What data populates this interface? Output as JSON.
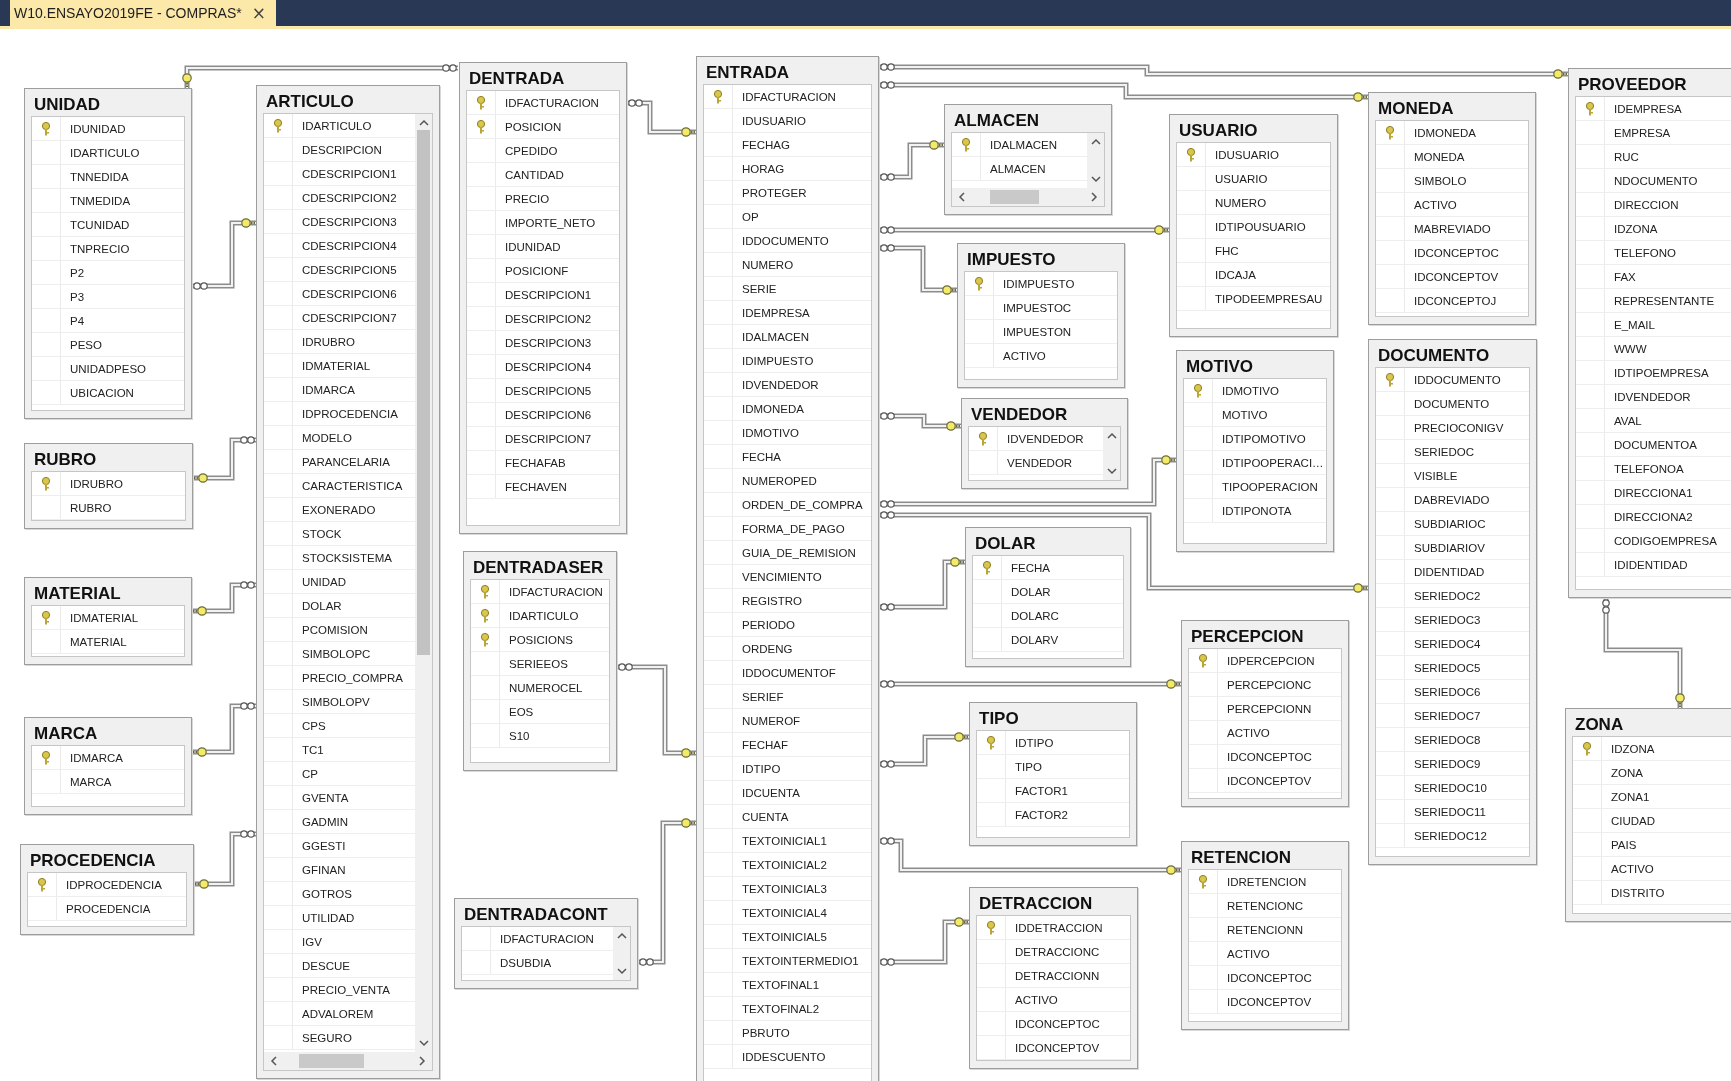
{
  "tab": {
    "title": "W10.ENSAYO2019FE - COMPRAS*",
    "close": "×",
    "selected": true
  },
  "tables": [
    {
      "name": "UNIDAD",
      "columns": [
        {
          "name": "IDUNIDAD",
          "key": true
        },
        {
          "name": "IDARTICULO",
          "key": false
        },
        {
          "name": "TNNEDIDA",
          "key": false
        },
        {
          "name": "TNMEDIDA",
          "key": false
        },
        {
          "name": "TCUNIDAD",
          "key": false
        },
        {
          "name": "TNPRECIO",
          "key": false
        },
        {
          "name": "P2",
          "key": false
        },
        {
          "name": "P3",
          "key": false
        },
        {
          "name": "P4",
          "key": false
        },
        {
          "name": "PESO",
          "key": false
        },
        {
          "name": "UNIDADPESO",
          "key": false
        },
        {
          "name": "UBICACION",
          "key": false
        }
      ]
    },
    {
      "name": "RUBRO",
      "columns": [
        {
          "name": "IDRUBRO",
          "key": true
        },
        {
          "name": "RUBRO",
          "key": false
        }
      ]
    },
    {
      "name": "MATERIAL",
      "columns": [
        {
          "name": "IDMATERIAL",
          "key": true
        },
        {
          "name": "MATERIAL",
          "key": false
        }
      ]
    },
    {
      "name": "MARCA",
      "columns": [
        {
          "name": "IDMARCA",
          "key": true
        },
        {
          "name": "MARCA",
          "key": false
        }
      ]
    },
    {
      "name": "PROCEDENCIA",
      "columns": [
        {
          "name": "IDPROCEDENCIA",
          "key": true
        },
        {
          "name": "PROCEDENCIA",
          "key": false
        }
      ]
    },
    {
      "name": "ARTICULO",
      "columns": [
        {
          "name": "IDARTICULO",
          "key": true
        },
        {
          "name": "DESCRIPCION",
          "key": false
        },
        {
          "name": "CDESCRIPCION1",
          "key": false
        },
        {
          "name": "CDESCRIPCION2",
          "key": false
        },
        {
          "name": "CDESCRIPCION3",
          "key": false
        },
        {
          "name": "CDESCRIPCION4",
          "key": false
        },
        {
          "name": "CDESCRIPCION5",
          "key": false
        },
        {
          "name": "CDESCRIPCION6",
          "key": false
        },
        {
          "name": "CDESCRIPCION7",
          "key": false
        },
        {
          "name": "IDRUBRO",
          "key": false
        },
        {
          "name": "IDMATERIAL",
          "key": false
        },
        {
          "name": "IDMARCA",
          "key": false
        },
        {
          "name": "IDPROCEDENCIA",
          "key": false
        },
        {
          "name": "MODELO",
          "key": false
        },
        {
          "name": "PARANCELARIA",
          "key": false
        },
        {
          "name": "CARACTERISTICA",
          "key": false
        },
        {
          "name": "EXONERADO",
          "key": false
        },
        {
          "name": "STOCK",
          "key": false
        },
        {
          "name": "STOCKSISTEMA",
          "key": false
        },
        {
          "name": "UNIDAD",
          "key": false
        },
        {
          "name": "DOLAR",
          "key": false
        },
        {
          "name": "PCOMISION",
          "key": false
        },
        {
          "name": "SIMBOLOPC",
          "key": false
        },
        {
          "name": "PRECIO_COMPRA",
          "key": false
        },
        {
          "name": "SIMBOLOPV",
          "key": false
        },
        {
          "name": "CPS",
          "key": false
        },
        {
          "name": "TC1",
          "key": false
        },
        {
          "name": "CP",
          "key": false
        },
        {
          "name": "GVENTA",
          "key": false
        },
        {
          "name": "GADMIN",
          "key": false
        },
        {
          "name": "GGESTI",
          "key": false
        },
        {
          "name": "GFINAN",
          "key": false
        },
        {
          "name": "GOTROS",
          "key": false
        },
        {
          "name": "UTILIDAD",
          "key": false
        },
        {
          "name": "IGV",
          "key": false
        },
        {
          "name": "DESCUE",
          "key": false
        },
        {
          "name": "PRECIO_VENTA",
          "key": false
        },
        {
          "name": "ADVALOREM",
          "key": false
        },
        {
          "name": "SEGURO",
          "key": false
        }
      ]
    },
    {
      "name": "DENTRADA",
      "columns": [
        {
          "name": "IDFACTURACION",
          "key": true
        },
        {
          "name": "POSICION",
          "key": true
        },
        {
          "name": "CPEDIDO",
          "key": false
        },
        {
          "name": "CANTIDAD",
          "key": false
        },
        {
          "name": "PRECIO",
          "key": false
        },
        {
          "name": "IMPORTE_NETO",
          "key": false
        },
        {
          "name": "IDUNIDAD",
          "key": false
        },
        {
          "name": "POSICIONF",
          "key": false
        },
        {
          "name": "DESCRIPCION1",
          "key": false
        },
        {
          "name": "DESCRIPCION2",
          "key": false
        },
        {
          "name": "DESCRIPCION3",
          "key": false
        },
        {
          "name": "DESCRIPCION4",
          "key": false
        },
        {
          "name": "DESCRIPCION5",
          "key": false
        },
        {
          "name": "DESCRIPCION6",
          "key": false
        },
        {
          "name": "DESCRIPCION7",
          "key": false
        },
        {
          "name": "FECHAFAB",
          "key": false
        },
        {
          "name": "FECHAVEN",
          "key": false
        }
      ]
    },
    {
      "name": "DENTRADASER",
      "columns": [
        {
          "name": "IDFACTURACION",
          "key": true
        },
        {
          "name": "IDARTICULO",
          "key": true
        },
        {
          "name": "POSICIONS",
          "key": true
        },
        {
          "name": "SERIEEOS",
          "key": false
        },
        {
          "name": "NUMEROCEL",
          "key": false
        },
        {
          "name": "EOS",
          "key": false
        },
        {
          "name": "S10",
          "key": false
        }
      ]
    },
    {
      "name": "DENTRADACONT",
      "columns": [
        {
          "name": "IDFACTURACION",
          "key": false
        },
        {
          "name": "DSUBDIA",
          "key": false
        }
      ]
    },
    {
      "name": "ENTRADA",
      "columns": [
        {
          "name": "IDFACTURACION",
          "key": true
        },
        {
          "name": "IDUSUARIO",
          "key": false
        },
        {
          "name": "FECHAG",
          "key": false
        },
        {
          "name": "HORAG",
          "key": false
        },
        {
          "name": "PROTEGER",
          "key": false
        },
        {
          "name": "OP",
          "key": false
        },
        {
          "name": "IDDOCUMENTO",
          "key": false
        },
        {
          "name": "NUMERO",
          "key": false
        },
        {
          "name": "SERIE",
          "key": false
        },
        {
          "name": "IDEMPRESA",
          "key": false
        },
        {
          "name": "IDALMACEN",
          "key": false
        },
        {
          "name": "IDIMPUESTO",
          "key": false
        },
        {
          "name": "IDVENDEDOR",
          "key": false
        },
        {
          "name": "IDMONEDA",
          "key": false
        },
        {
          "name": "IDMOTIVO",
          "key": false
        },
        {
          "name": "FECHA",
          "key": false
        },
        {
          "name": "NUMEROPED",
          "key": false
        },
        {
          "name": "ORDEN_DE_COMPRA",
          "key": false
        },
        {
          "name": "FORMA_DE_PAGO",
          "key": false
        },
        {
          "name": "GUIA_DE_REMISION",
          "key": false
        },
        {
          "name": "VENCIMIENTO",
          "key": false
        },
        {
          "name": "REGISTRO",
          "key": false
        },
        {
          "name": "PERIODO",
          "key": false
        },
        {
          "name": "ORDENG",
          "key": false
        },
        {
          "name": "IDDOCUMENTOF",
          "key": false
        },
        {
          "name": "SERIEF",
          "key": false
        },
        {
          "name": "NUMEROF",
          "key": false
        },
        {
          "name": "FECHAF",
          "key": false
        },
        {
          "name": "IDTIPO",
          "key": false
        },
        {
          "name": "IDCUENTA",
          "key": false
        },
        {
          "name": "CUENTA",
          "key": false
        },
        {
          "name": "TEXTOINICIAL1",
          "key": false
        },
        {
          "name": "TEXTOINICIAL2",
          "key": false
        },
        {
          "name": "TEXTOINICIAL3",
          "key": false
        },
        {
          "name": "TEXTOINICIAL4",
          "key": false
        },
        {
          "name": "TEXTOINICIAL5",
          "key": false
        },
        {
          "name": "TEXTOINTERMEDIO1",
          "key": false
        },
        {
          "name": "TEXTOFINAL1",
          "key": false
        },
        {
          "name": "TEXTOFINAL2",
          "key": false
        },
        {
          "name": "PBRUTO",
          "key": false
        },
        {
          "name": "IDDESCUENTO",
          "key": false
        }
      ]
    },
    {
      "name": "ALMACEN",
      "columns": [
        {
          "name": "IDALMACEN",
          "key": true
        },
        {
          "name": "ALMACEN",
          "key": false
        }
      ]
    },
    {
      "name": "IMPUESTO",
      "columns": [
        {
          "name": "IDIMPUESTO",
          "key": true
        },
        {
          "name": "IMPUESTOC",
          "key": false
        },
        {
          "name": "IMPUESTON",
          "key": false
        },
        {
          "name": "ACTIVO",
          "key": false
        }
      ]
    },
    {
      "name": "VENDEDOR",
      "columns": [
        {
          "name": "IDVENDEDOR",
          "key": true
        },
        {
          "name": "VENDEDOR",
          "key": false
        }
      ]
    },
    {
      "name": "DOLAR",
      "columns": [
        {
          "name": "FECHA",
          "key": true
        },
        {
          "name": "DOLAR",
          "key": false
        },
        {
          "name": "DOLARC",
          "key": false
        },
        {
          "name": "DOLARV",
          "key": false
        }
      ]
    },
    {
      "name": "TIPO",
      "columns": [
        {
          "name": "IDTIPO",
          "key": true
        },
        {
          "name": "TIPO",
          "key": false
        },
        {
          "name": "FACTOR1",
          "key": false
        },
        {
          "name": "FACTOR2",
          "key": false
        }
      ]
    },
    {
      "name": "DETRACCION",
      "columns": [
        {
          "name": "IDDETRACCION",
          "key": true
        },
        {
          "name": "DETRACCIONC",
          "key": false
        },
        {
          "name": "DETRACCIONN",
          "key": false
        },
        {
          "name": "ACTIVO",
          "key": false
        },
        {
          "name": "IDCONCEPTOC",
          "key": false
        },
        {
          "name": "IDCONCEPTOV",
          "key": false
        }
      ]
    },
    {
      "name": "USUARIO",
      "columns": [
        {
          "name": "IDUSUARIO",
          "key": true
        },
        {
          "name": "USUARIO",
          "key": false
        },
        {
          "name": "NUMERO",
          "key": false
        },
        {
          "name": "IDTIPOUSUARIO",
          "key": false
        },
        {
          "name": "FHC",
          "key": false
        },
        {
          "name": "IDCAJA",
          "key": false
        },
        {
          "name": "TIPODEEMPRESAU",
          "key": false
        }
      ]
    },
    {
      "name": "MOTIVO",
      "columns": [
        {
          "name": "IDMOTIVO",
          "key": true
        },
        {
          "name": "MOTIVO",
          "key": false
        },
        {
          "name": "IDTIPOMOTIVO",
          "key": false
        },
        {
          "name": "IDTIPOOPERACI…",
          "key": false
        },
        {
          "name": "TIPOOPERACION",
          "key": false
        },
        {
          "name": "IDTIPONOTA",
          "key": false
        }
      ]
    },
    {
      "name": "PERCEPCION",
      "columns": [
        {
          "name": "IDPERCEPCION",
          "key": true
        },
        {
          "name": "PERCEPCIONC",
          "key": false
        },
        {
          "name": "PERCEPCIONN",
          "key": false
        },
        {
          "name": "ACTIVO",
          "key": false
        },
        {
          "name": "IDCONCEPTOC",
          "key": false
        },
        {
          "name": "IDCONCEPTOV",
          "key": false
        }
      ]
    },
    {
      "name": "RETENCION",
      "columns": [
        {
          "name": "IDRETENCION",
          "key": true
        },
        {
          "name": "RETENCIONC",
          "key": false
        },
        {
          "name": "RETENCIONN",
          "key": false
        },
        {
          "name": "ACTIVO",
          "key": false
        },
        {
          "name": "IDCONCEPTOC",
          "key": false
        },
        {
          "name": "IDCONCEPTOV",
          "key": false
        }
      ]
    },
    {
      "name": "MONEDA",
      "columns": [
        {
          "name": "IDMONEDA",
          "key": true
        },
        {
          "name": "MONEDA",
          "key": false
        },
        {
          "name": "SIMBOLO",
          "key": false
        },
        {
          "name": "ACTIVO",
          "key": false
        },
        {
          "name": "MABREVIADO",
          "key": false
        },
        {
          "name": "IDCONCEPTOC",
          "key": false
        },
        {
          "name": "IDCONCEPTOV",
          "key": false
        },
        {
          "name": "IDCONCEPTOJ",
          "key": false
        }
      ]
    },
    {
      "name": "DOCUMENTO",
      "columns": [
        {
          "name": "IDDOCUMENTO",
          "key": true
        },
        {
          "name": "DOCUMENTO",
          "key": false
        },
        {
          "name": "PRECIOCONIGV",
          "key": false
        },
        {
          "name": "SERIEDOC",
          "key": false
        },
        {
          "name": "VISIBLE",
          "key": false
        },
        {
          "name": "DABREVIADO",
          "key": false
        },
        {
          "name": "SUBDIARIOC",
          "key": false
        },
        {
          "name": "SUBDIARIOV",
          "key": false
        },
        {
          "name": "DIDENTIDAD",
          "key": false
        },
        {
          "name": "SERIEDOC2",
          "key": false
        },
        {
          "name": "SERIEDOC3",
          "key": false
        },
        {
          "name": "SERIEDOC4",
          "key": false
        },
        {
          "name": "SERIEDOC5",
          "key": false
        },
        {
          "name": "SERIEDOC6",
          "key": false
        },
        {
          "name": "SERIEDOC7",
          "key": false
        },
        {
          "name": "SERIEDOC8",
          "key": false
        },
        {
          "name": "SERIEDOC9",
          "key": false
        },
        {
          "name": "SERIEDOC10",
          "key": false
        },
        {
          "name": "SERIEDOC11",
          "key": false
        },
        {
          "name": "SERIEDOC12",
          "key": false
        }
      ]
    },
    {
      "name": "PROVEEDOR",
      "columns": [
        {
          "name": "IDEMPRESA",
          "key": true
        },
        {
          "name": "EMPRESA",
          "key": false
        },
        {
          "name": "RUC",
          "key": false
        },
        {
          "name": "NDOCUMENTO",
          "key": false
        },
        {
          "name": "DIRECCION",
          "key": false
        },
        {
          "name": "IDZONA",
          "key": false
        },
        {
          "name": "TELEFONO",
          "key": false
        },
        {
          "name": "FAX",
          "key": false
        },
        {
          "name": "REPRESENTANTE",
          "key": false
        },
        {
          "name": "E_MAIL",
          "key": false
        },
        {
          "name": "WWW",
          "key": false
        },
        {
          "name": "IDTIPOEMPRESA",
          "key": false
        },
        {
          "name": "IDVENDEDOR",
          "key": false
        },
        {
          "name": "AVAL",
          "key": false
        },
        {
          "name": "DOCUMENTOA",
          "key": false
        },
        {
          "name": "TELEFONOA",
          "key": false
        },
        {
          "name": "DIRECCIONA1",
          "key": false
        },
        {
          "name": "DIRECCIONA2",
          "key": false
        },
        {
          "name": "CODIGOEMPRESA",
          "key": false
        },
        {
          "name": "IDIDENTIDAD",
          "key": false
        }
      ]
    },
    {
      "name": "ZONA",
      "columns": [
        {
          "name": "IDZONA",
          "key": true
        },
        {
          "name": "ZONA",
          "key": false
        },
        {
          "name": "ZONA1",
          "key": false
        },
        {
          "name": "CIUDAD",
          "key": false
        },
        {
          "name": "PAIS",
          "key": false
        },
        {
          "name": "ACTIVO",
          "key": false
        },
        {
          "name": "DISTRITO",
          "key": false
        }
      ]
    }
  ]
}
